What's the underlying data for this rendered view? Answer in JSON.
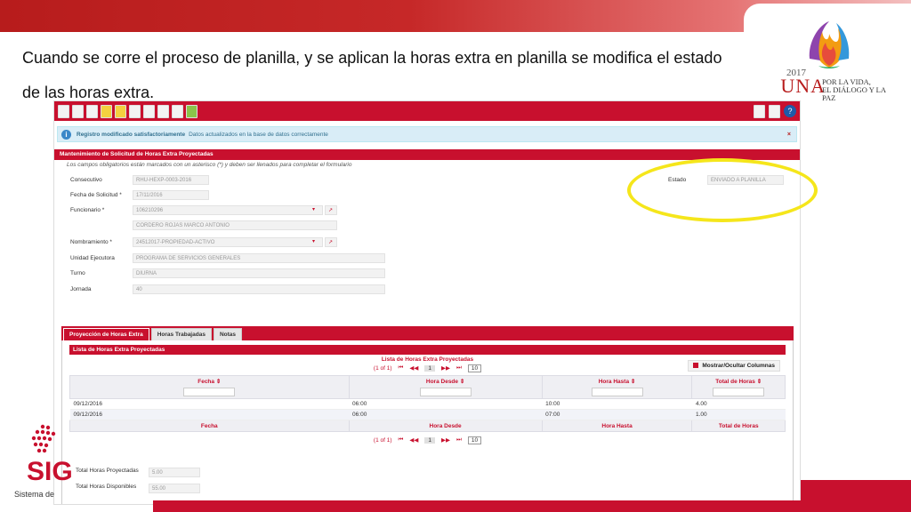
{
  "slide": {
    "text": "Cuando se corre el proceso de planilla, y se aplican la horas extra en planilla se modifica el estado de las horas extra.",
    "logo": {
      "year": "2017",
      "una": "UNA",
      "motto_line1": "POR LA VIDA,",
      "motto_line2": "EL DIÁLOGO Y LA PAZ"
    },
    "brand": {
      "name": "SIG",
      "subtitle": "Sistema de"
    }
  },
  "app": {
    "message": {
      "title": "Registro modificado satisfactoriamente",
      "detail": "Datos actualizados en la base de datos correctamente",
      "close": "×"
    },
    "section_title": "Mantenimiento de Solicitud de Horas Extra Proyectadas",
    "required_note": "Los campos obligatorios están marcados con un asterisco (*) y deben ser llenados para completar el formulario",
    "form": {
      "consecutivo_label": "Consecutivo",
      "consecutivo_value": "RHU-HEXP-0003-2016",
      "fecha_label": "Fecha de Solicitud *",
      "fecha_value": "17/11/2016",
      "funcionario_label": "Funcionario *",
      "funcionario_id": "106210296",
      "funcionario_name": "CORDERO ROJAS MARCO ANTONIO",
      "nombramiento_label": "Nombramiento *",
      "nombramiento_value": "24512017-PROPIEDAD-ACTIVO",
      "unidad_label": "Unidad Ejecutora",
      "unidad_value": "PROGRAMA DE SERVICIOS GENERALES",
      "turno_label": "Turno",
      "turno_value": "DIURNA",
      "jornada_label": "Jornada",
      "jornada_value": "40",
      "estado_label": "Estado",
      "estado_value": "ENVIADO A PLANILLA"
    },
    "tabs": [
      {
        "label": "Proyección de Horas Extra"
      },
      {
        "label": "Horas Trabajadas"
      },
      {
        "label": "Notas"
      }
    ],
    "list": {
      "header": "Lista de Horas Extra Proyectadas",
      "caption": "Lista de Horas Extra Proyectadas",
      "toggle_columns": "Mostrar/Ocultar Columnas",
      "pager_text": "(1 of 1)",
      "page": "1",
      "rows_per_page": "10",
      "columns": [
        "Fecha",
        "Hora Desde",
        "Hora Hasta",
        "Total de Horas"
      ],
      "rows": [
        [
          "09/12/2016",
          "06:00",
          "10:00",
          "4.00"
        ],
        [
          "09/12/2016",
          "06:00",
          "07:00",
          "1.00"
        ]
      ]
    },
    "totals": {
      "proyectadas_label": "Total Horas Proyectadas",
      "proyectadas_value": "5.00",
      "disponibles_label": "Total Horas Disponibles",
      "disponibles_value": "55.00"
    }
  }
}
